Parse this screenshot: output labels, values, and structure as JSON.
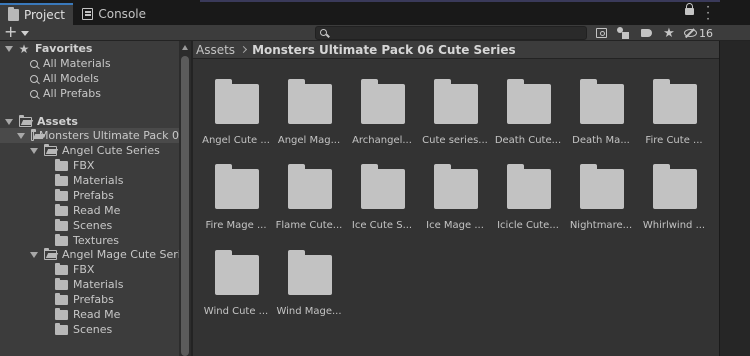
{
  "tabs": [
    {
      "label": "Project",
      "active": true,
      "icon": "folder-icon"
    },
    {
      "label": "Console",
      "active": false,
      "icon": "console-icon"
    }
  ],
  "toolbar": {
    "create_label": "+",
    "search_value": "",
    "hidden_packages_count": "16"
  },
  "tree": {
    "favorites": {
      "label": "Favorites",
      "items": [
        "All Materials",
        "All Models",
        "All Prefabs"
      ]
    },
    "assets": {
      "label": "Assets",
      "pack": "Monsters Ultimate Pack 0",
      "angel_cute": {
        "label": "Angel Cute Series",
        "children": [
          "FBX",
          "Materials",
          "Prefabs",
          "Read Me",
          "Scenes",
          "Textures"
        ]
      },
      "angel_mage": {
        "label": "Angel Mage Cute Series",
        "children": [
          "FBX",
          "Materials",
          "Prefabs",
          "Read Me",
          "Scenes"
        ]
      }
    }
  },
  "breadcrumb": {
    "root": "Assets",
    "current": "Monsters Ultimate Pack 06 Cute Series"
  },
  "folders": [
    "Angel Cute ...",
    "Angel Mag...",
    "Archangel...",
    "Cute series...",
    "Death Cute...",
    "Death Ma...",
    "Fire Cute ...",
    "Fire Mage ...",
    "Flame Cute...",
    "Ice Cute S...",
    "Ice Mage ...",
    "Icicle Cute...",
    "Nightmare...",
    "Whirlwind ...",
    "Wind Cute ...",
    "Wind Mage..."
  ],
  "colors": {
    "selected_row": "#4a4a4a",
    "active_tab_accent": "#3a79bb",
    "folder": "#c2c2c2"
  }
}
